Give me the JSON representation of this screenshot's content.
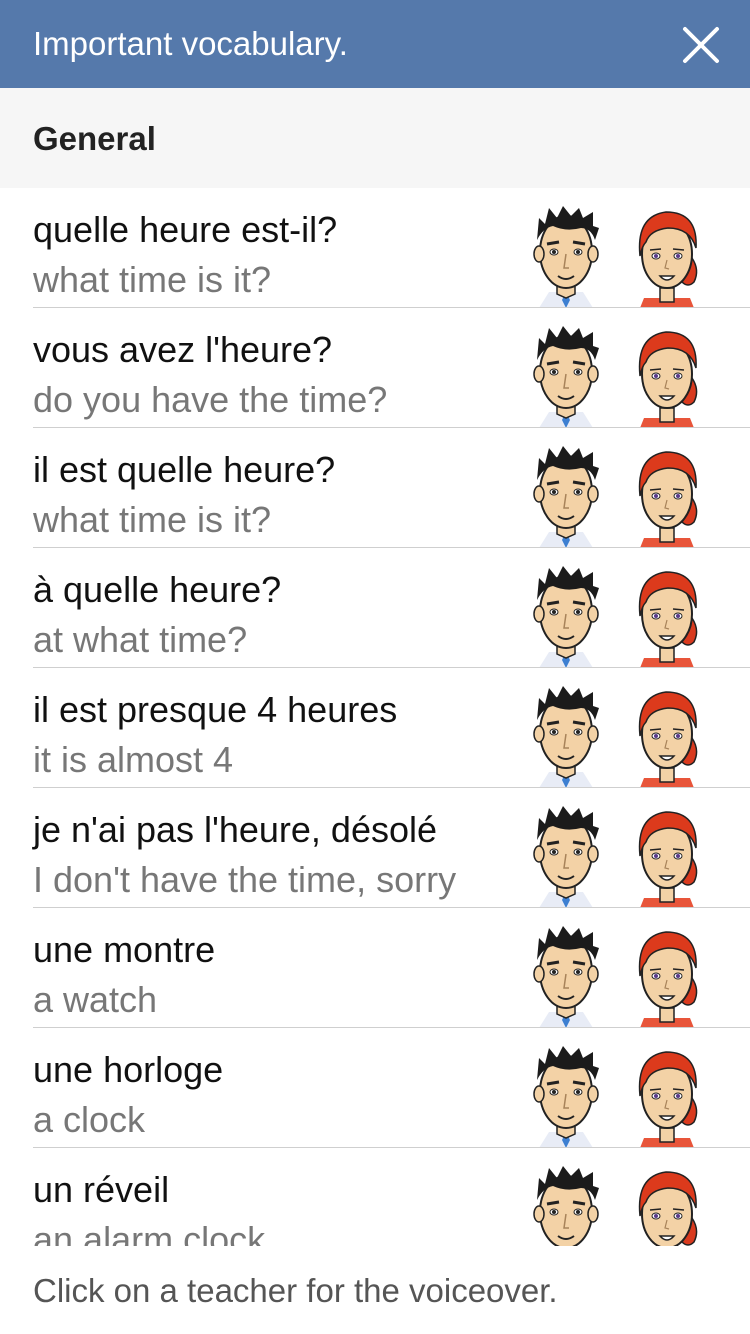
{
  "header": {
    "title": "Important vocabulary."
  },
  "section": {
    "title": "General"
  },
  "items": [
    {
      "fr": "quelle heure est-il?",
      "en": "what time is it?"
    },
    {
      "fr": "vous avez l'heure?",
      "en": "do you have the time?"
    },
    {
      "fr": "il est quelle heure?",
      "en": "what time is it?"
    },
    {
      "fr": "à quelle heure?",
      "en": "at what time?"
    },
    {
      "fr": "il est presque 4 heures",
      "en": "it is almost 4"
    },
    {
      "fr": "je n'ai pas l'heure, désolé",
      "en": "I don't have the time, sorry"
    },
    {
      "fr": "une montre",
      "en": "a watch"
    },
    {
      "fr": "une horloge",
      "en": "a clock"
    },
    {
      "fr": "un réveil",
      "en": "an alarm clock"
    }
  ],
  "footer": {
    "hint": "Click on a teacher for the voiceover."
  },
  "colors": {
    "header_bg": "#5579ab",
    "section_bg": "#f6f6f6",
    "fr_text": "#111111",
    "en_text": "#777777",
    "divider": "#cfcfcf"
  },
  "icons": {
    "close": "close-icon",
    "male_teacher": "male-teacher-avatar-icon",
    "female_teacher": "female-teacher-avatar-icon"
  }
}
